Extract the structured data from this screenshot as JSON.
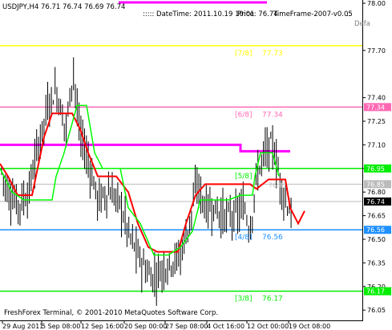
{
  "header": {
    "symbol_line": "USDJPY,H4  76.71 76.74 76.69 76.74",
    "server_info": "::::: DateTime: 2011.10.19 10:01",
    "price_info": "Price: 76.74",
    "timeframe_info": "TimeFrame-2007-v0.05",
    "dots": "::",
    "def_label": "Defa"
  },
  "footer": {
    "copyright": "FreshForex Terminal, © 2001-2010 MetaQuotes Software Corp."
  },
  "colors": {
    "candles": "#000000",
    "red_line": "#ff0000",
    "green_line": "#00ff00",
    "magenta": "#ff00ff",
    "yellow": "#ffff00",
    "pink": "#ff69b4",
    "blue": "#1e90ff",
    "lime": "#00ee00",
    "gray_level": "#bbbbbb",
    "ask_bid_box": "#000000"
  },
  "chart_data": {
    "type": "candlestick",
    "symbol": "USDJPY",
    "timeframe": "H4",
    "ylim": [
      76.0,
      78.0
    ],
    "x_tick_labels": [
      "29 Aug 2011",
      "5 Sep 08:00",
      "12 Sep 16:00",
      "20 Sep 00:00",
      "27 Sep 08:00",
      "4 Oct 16:00",
      "12 Oct 00:00",
      "19 Oct 08:00"
    ],
    "y_tick_labels": [
      "78.00",
      "77.70",
      "77.40",
      "77.25",
      "77.10",
      "76.95",
      "76.80",
      "76.65",
      "76.50",
      "76.35",
      "76.20",
      "76.05"
    ],
    "murrey_levels": [
      {
        "label": "[7/8]",
        "value_label": "77.73",
        "price": 77.73,
        "color": "#ffff00"
      },
      {
        "label": "[6/8]",
        "value_label": "77.34",
        "price": 77.34,
        "color": "#ff69b4"
      },
      {
        "label": "[5/8]",
        "value_label": "",
        "price": 76.95,
        "color": "#00ee00"
      },
      {
        "label": "[4/8]",
        "value_label": "76.56",
        "price": 76.56,
        "color": "#1e90ff"
      },
      {
        "label": "[3/8]",
        "value_label": "76.17",
        "price": 76.17,
        "color": "#00ee00"
      }
    ],
    "right_price_boxes": [
      {
        "text": "77.34",
        "price": 77.34,
        "color": "#ff69b4"
      },
      {
        "text": "76.95",
        "price": 76.95,
        "color": "#00ee00"
      },
      {
        "text": "76.85",
        "price": 76.85,
        "color": "#bbbbbb"
      },
      {
        "text": "76.74",
        "price": 76.74,
        "color": "#000000"
      },
      {
        "text": "76.56",
        "price": 76.56,
        "color": "#1e90ff"
      },
      {
        "text": "76.17",
        "price": 76.17,
        "color": "#00ee00"
      }
    ],
    "magenta_level": 77.1,
    "gray_levels": [
      76.85,
      76.74
    ],
    "faint_labels": [
      "76.81"
    ],
    "grid": false
  }
}
